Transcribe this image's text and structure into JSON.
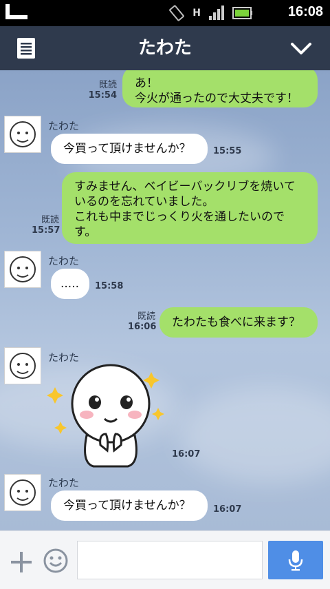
{
  "status_bar": {
    "time": "16:08",
    "network": "H"
  },
  "header": {
    "title": "たわた"
  },
  "messages": [
    {
      "dir": "out",
      "text": "あ！\n今火が通ったので大丈夫です！",
      "read": "既読",
      "time": "15:54"
    },
    {
      "dir": "in",
      "sender": "たわた",
      "text": "今買って頂けませんか？",
      "time": "15:55"
    },
    {
      "dir": "out",
      "text": "すみません、ベイビーバックリブを焼いているのを忘れていました。\nこれも中までじっくり火を通したいのです。",
      "read": "既読",
      "time": "15:57"
    },
    {
      "dir": "in",
      "sender": "たわた",
      "text": ".....",
      "time": "15:58"
    },
    {
      "dir": "out",
      "text": "たわたも食べに来ます？",
      "read": "既読",
      "time": "16:06"
    },
    {
      "dir": "in",
      "sender": "たわた",
      "sticker": "moon-sticker",
      "time": "16:07"
    },
    {
      "dir": "in",
      "sender": "たわた",
      "text": "今買って頂けませんか？",
      "time": "16:07"
    }
  ],
  "input": {
    "placeholder": ""
  },
  "colors": {
    "header": "#2f3a4d",
    "outgoing": "#a4e06a",
    "incoming": "#ffffff",
    "send": "#4f8ee6"
  }
}
